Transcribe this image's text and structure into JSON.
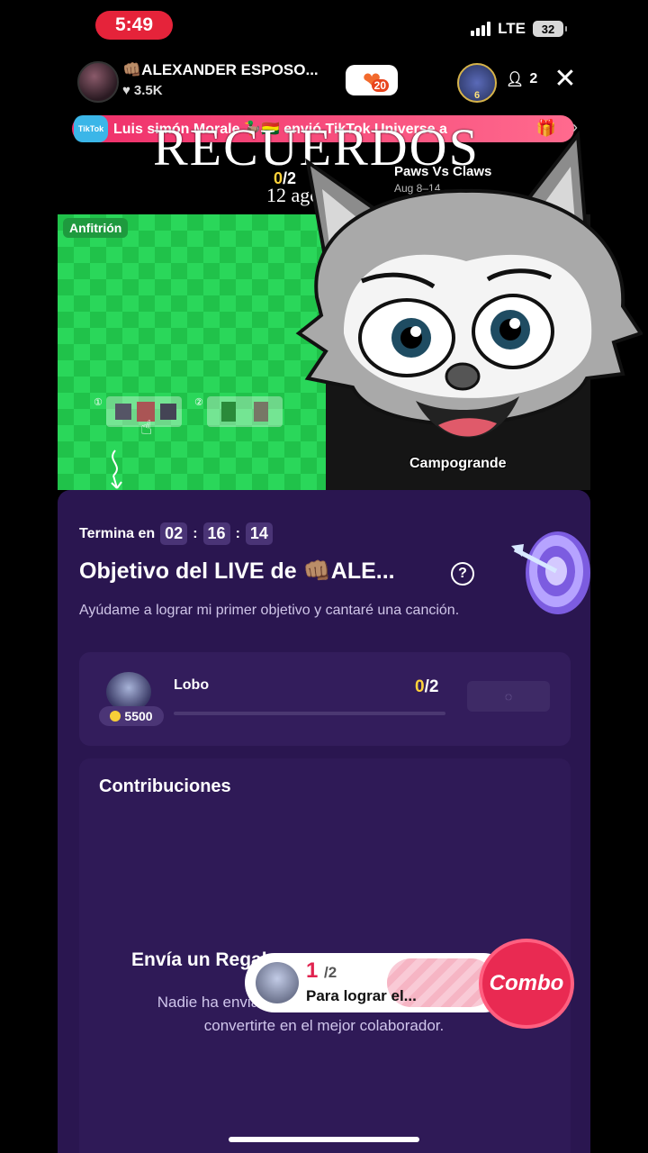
{
  "status_bar": {
    "time": "5:49",
    "network": "LTE",
    "battery": "32"
  },
  "host": {
    "name": "👊🏽ALEXANDER ESPOSO...",
    "likes": "3.5K",
    "like_badge": "20",
    "rank_badge": "6",
    "viewers": "2"
  },
  "banner": {
    "logo": "TikTok",
    "text": "Luis simón Morale 🦆🇧🇴 envió TikTok Universe a"
  },
  "overlay": {
    "title": "RECUERDOS",
    "date": "12 ago"
  },
  "battle": {
    "score_current": "0",
    "score_total": "/2",
    "event_title": "Paws Vs Claws",
    "event_dates": "Aug 8–14"
  },
  "video": {
    "host_tag": "Anfitrión",
    "thumb1_index": "①",
    "thumb2_index": "②",
    "guest_name": "Campogrande"
  },
  "goal": {
    "ends_label": "Termina en",
    "hh": "02",
    "mm": "16",
    "ss": "14",
    "sep": ":",
    "title": "Objetivo del LIVE de 👊🏽ALE...",
    "help": "?",
    "description": "Ayúdame a lograr mi primer objetivo y cantaré una canción."
  },
  "gift": {
    "name": "Lobo",
    "coins": "5500",
    "count_current": "0",
    "count_total": "/2",
    "progress": 0,
    "button": "◌"
  },
  "contributions": {
    "title": "Contribuciones",
    "empty_title": "Envía un Regalo",
    "empty_text": "Nadie ha enviado regalos. Un solo Regalo puede convertirte en el mejor colaborador."
  },
  "combo": {
    "count": "1",
    "of": "/2",
    "label": "Para lograr el...",
    "button": "Combo"
  },
  "icons": {
    "close": "close-icon",
    "heart": "heart-icon",
    "person": "person-icon",
    "gift": "gift-icon",
    "chevron": "chevron-right-icon",
    "help": "help-icon",
    "coin": "coin-icon",
    "target": "target-icon",
    "wolf": "wolf-sticker"
  },
  "colors": {
    "accent_red": "#e5233a",
    "panel": "#2a1650",
    "combo": "#e92a52",
    "green_screen": "#20c24a",
    "gold": "#ffd23a"
  }
}
